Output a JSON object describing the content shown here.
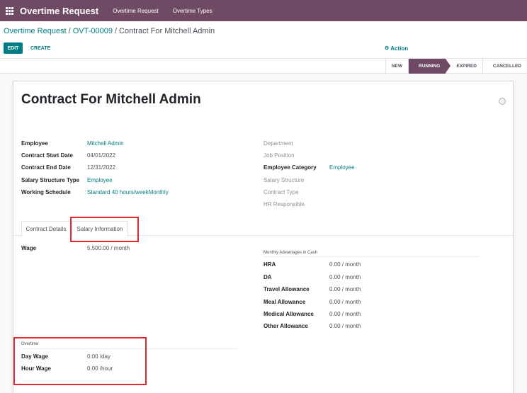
{
  "navbar": {
    "app_name": "Overtime Request",
    "menu": [
      "Overtime Request",
      "Overtime Types"
    ]
  },
  "breadcrumb": {
    "parent": "Overtime Request",
    "record": "OVT-00009",
    "current": "Contract For Mitchell Admin",
    "separator": "/"
  },
  "buttons": {
    "edit": "EDIT",
    "create": "CREATE",
    "action": "Action"
  },
  "statusbar": {
    "stages": [
      "NEW",
      "RUNNING",
      "EXPIRED",
      "CANCELLED"
    ],
    "active": "RUNNING"
  },
  "form": {
    "title": "Contract For Mitchell Admin",
    "left_fields": [
      {
        "label": "Employee",
        "value": "Mitchell Admin"
      },
      {
        "label": "Contract Start Date",
        "value": "04/01/2022"
      },
      {
        "label": "Contract End Date",
        "value": "12/31/2022"
      },
      {
        "label": "Salary Structure Type",
        "value": "Employee"
      },
      {
        "label": "Working Schedule",
        "value": "Standard 40 hours/weekMonthly"
      }
    ],
    "right_fields": [
      {
        "label": "Department",
        "value": ""
      },
      {
        "label": "Job Position",
        "value": ""
      },
      {
        "label": "Employee Category",
        "value": "Employee"
      },
      {
        "label": "Salary Structure",
        "value": ""
      },
      {
        "label": "Contract Type",
        "value": ""
      },
      {
        "label": "HR Responsible",
        "value": ""
      }
    ]
  },
  "tabs": [
    "Contract Details",
    "Salary Information"
  ],
  "active_tab": "Salary Information",
  "salary": {
    "wage_label": "Wage",
    "wage_value": "5,500.00 / month",
    "advantages_header": "Monthly Advantages in Cash",
    "advantages": [
      {
        "label": "HRA",
        "value": "0.00 / month"
      },
      {
        "label": "DA",
        "value": "0.00 / month"
      },
      {
        "label": "Travel Allowance",
        "value": "0.00 / month"
      },
      {
        "label": "Meal Allowance",
        "value": "0.00 / month"
      },
      {
        "label": "Medical Allowance",
        "value": "0.00 / month"
      },
      {
        "label": "Other Allowance",
        "value": "0.00 / month"
      }
    ],
    "overtime_header": "Overtime",
    "overtime": [
      {
        "label": "Day Wage",
        "value": "0.00 /day"
      },
      {
        "label": "Hour Wage",
        "value": "0.00 /hour"
      }
    ]
  },
  "colors": {
    "brand": "#6f4a65",
    "link": "#017e84",
    "highlight": "#e3262c"
  }
}
